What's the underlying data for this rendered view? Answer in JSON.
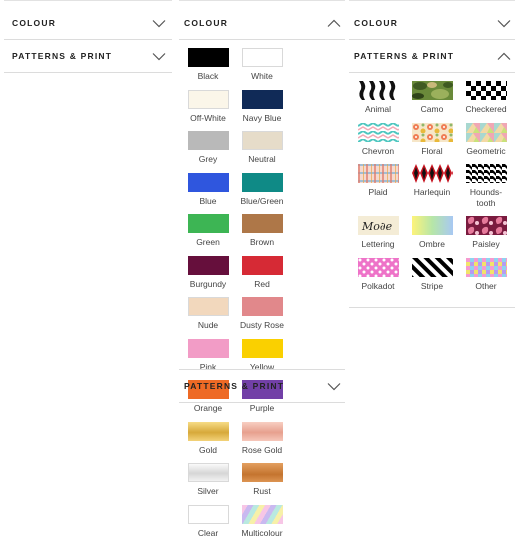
{
  "panel1": {
    "colour_title": "COLOUR",
    "patterns_title": "PATTERNS & PRINT"
  },
  "panel2": {
    "colour_title": "COLOUR",
    "patterns_title": "PATTERNS & PRINT",
    "colours": [
      {
        "label": "Black",
        "color": "#000000"
      },
      {
        "label": "White",
        "color": "#ffffff"
      },
      {
        "label": "Off-White",
        "color": "#fbf6e9"
      },
      {
        "label": "Navy Blue",
        "color": "#102a57"
      },
      {
        "label": "Grey",
        "color": "#b9b9b9"
      },
      {
        "label": "Neutral",
        "color": "#e6dcc9"
      },
      {
        "label": "Blue",
        "color": "#2f56de"
      },
      {
        "label": "Blue/Green",
        "color": "#0f8a86"
      },
      {
        "label": "Green",
        "color": "#3db554"
      },
      {
        "label": "Brown",
        "color": "#ae7748"
      },
      {
        "label": "Burgundy",
        "color": "#660f3c"
      },
      {
        "label": "Red",
        "color": "#d62a35"
      },
      {
        "label": "Nude",
        "color": "#f2d8bd"
      },
      {
        "label": "Dusty Rose",
        "color": "#e1888b"
      },
      {
        "label": "Pink",
        "color": "#f29cc6"
      },
      {
        "label": "Yellow",
        "color": "#fad000"
      },
      {
        "label": "Orange",
        "color": "#ee6a25"
      },
      {
        "label": "Purple",
        "color": "#7240a7"
      },
      {
        "label": "Gold",
        "color": "#e6c35a"
      },
      {
        "label": "Rose Gold",
        "color": "#efb4a6"
      },
      {
        "label": "Silver",
        "color": "#e4e4e4"
      },
      {
        "label": "Rust",
        "color": "#d08440"
      },
      {
        "label": "Clear",
        "color": "#ffffff"
      },
      {
        "label": "Multicolour",
        "color": "#c9b9f0"
      }
    ]
  },
  "panel3": {
    "colour_title": "COLOUR",
    "patterns_title": "PATTERNS & PRINT",
    "patterns": [
      {
        "label": "Animal"
      },
      {
        "label": "Camo"
      },
      {
        "label": "Checkered"
      },
      {
        "label": "Chevron"
      },
      {
        "label": "Floral"
      },
      {
        "label": "Geometric"
      },
      {
        "label": "Plaid"
      },
      {
        "label": "Harlequin"
      },
      {
        "label": "Hounds-tooth"
      },
      {
        "label": "Lettering"
      },
      {
        "label": "Ombre"
      },
      {
        "label": "Paisley"
      },
      {
        "label": "Polkadot"
      },
      {
        "label": "Stripe"
      },
      {
        "label": "Other"
      }
    ]
  }
}
